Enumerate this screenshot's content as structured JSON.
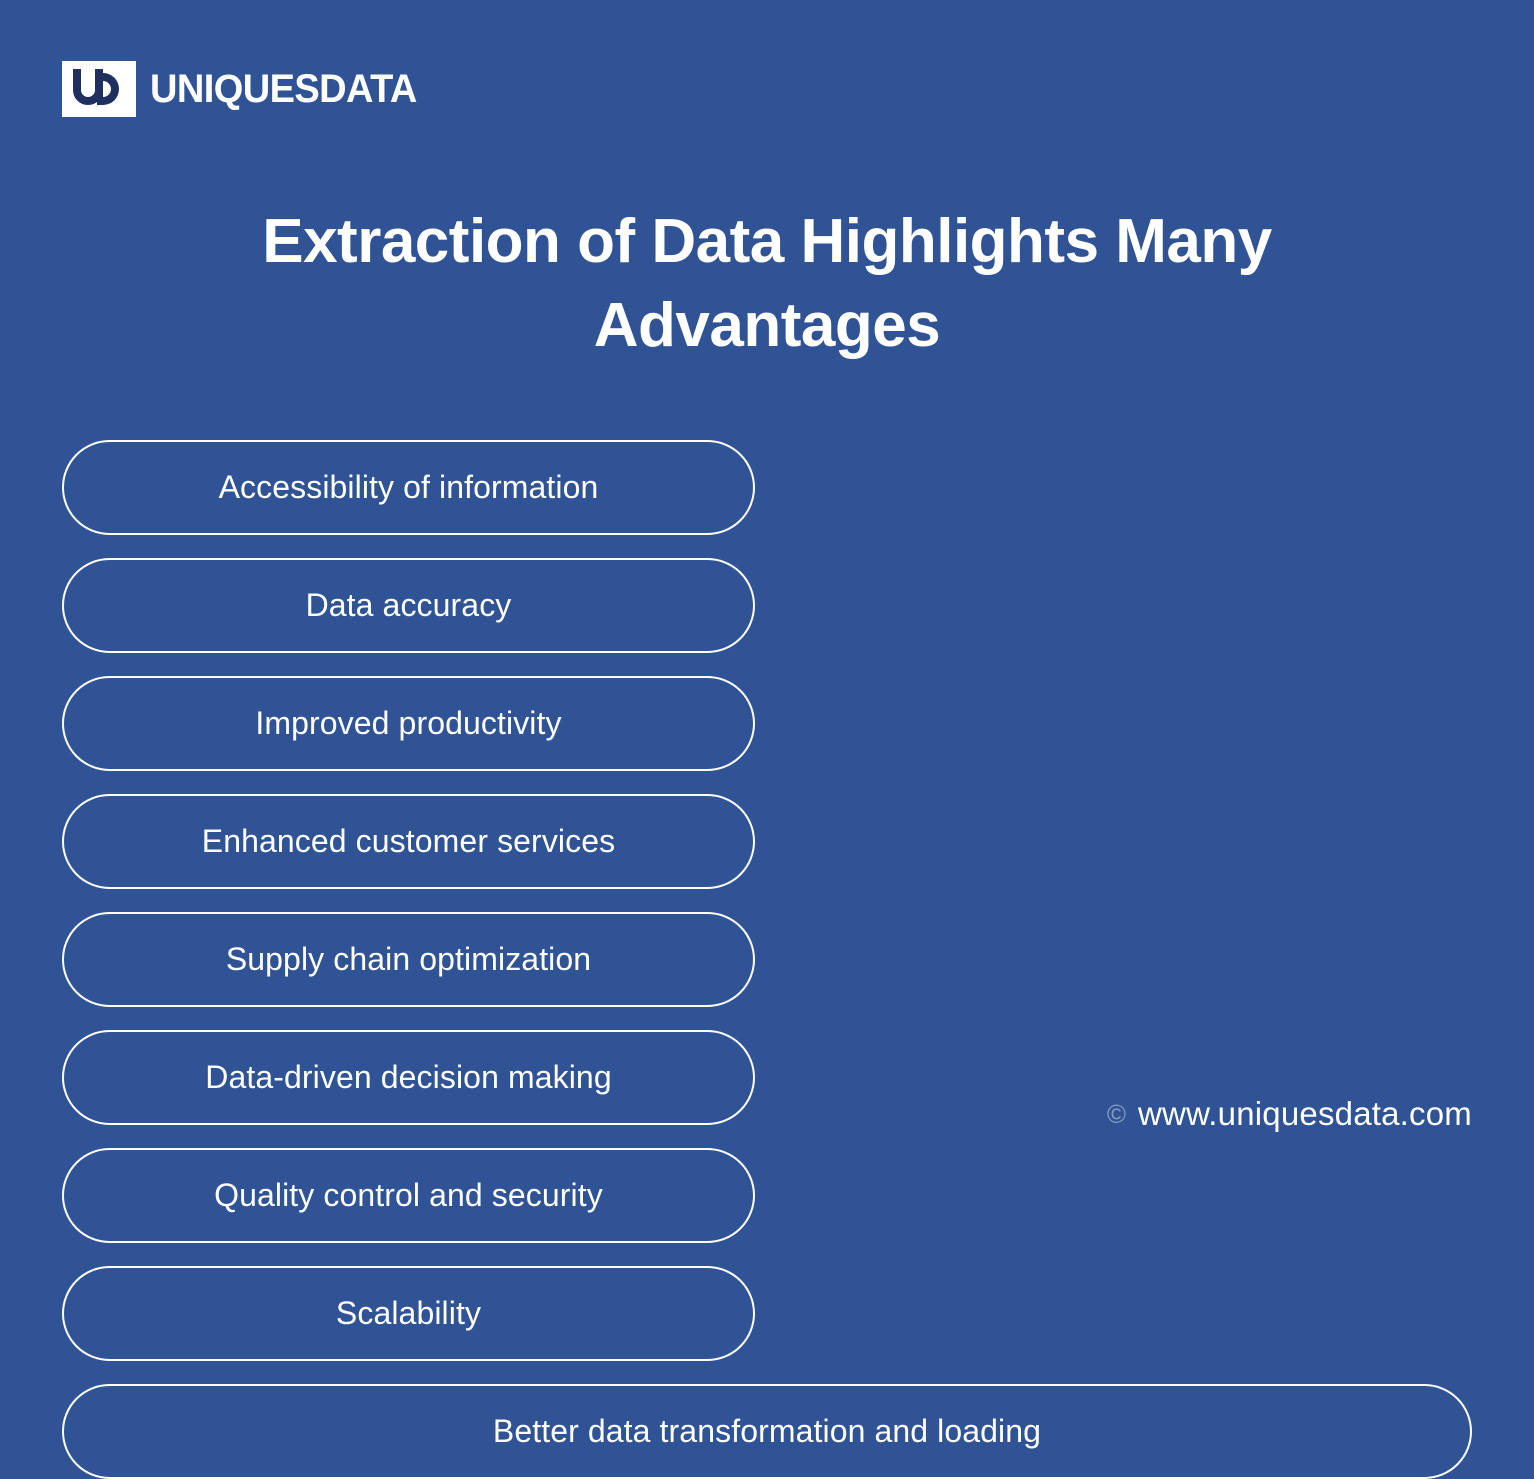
{
  "theme": {
    "background": "#2f5394",
    "foreground": "#ffffff",
    "logo_mark_bg": "#ffffff",
    "logo_mark_fg": "#1f2f5e",
    "pill_border": "#ffffff",
    "copyright_symbol_color": "rgba(255,255,255,0.42)"
  },
  "brand": {
    "logo_icon": "ud-monogram-icon",
    "name": "UNIQUESDATA"
  },
  "title": "Extraction of Data Highlights Many Advantages",
  "advantages": [
    {
      "label": "Accessibility of information",
      "column": "left",
      "row": 1,
      "full_width": false
    },
    {
      "label": "Data accuracy",
      "column": "right",
      "row": 1,
      "full_width": false
    },
    {
      "label": "Improved productivity",
      "column": "left",
      "row": 2,
      "full_width": false
    },
    {
      "label": "Enhanced customer services",
      "column": "right",
      "row": 2,
      "full_width": false
    },
    {
      "label": "Supply chain optimization",
      "column": "left",
      "row": 3,
      "full_width": false
    },
    {
      "label": "Data-driven decision making",
      "column": "right",
      "row": 3,
      "full_width": false
    },
    {
      "label": "Quality control and security",
      "column": "left",
      "row": 4,
      "full_width": false
    },
    {
      "label": "Scalability",
      "column": "right",
      "row": 4,
      "full_width": false
    },
    {
      "label": "Better data transformation and loading",
      "column": "full",
      "row": 5,
      "full_width": true
    }
  ],
  "footer": {
    "copyright_icon": "copyright-icon",
    "copyright_symbol": "©",
    "url": "www.uniquesdata.com"
  }
}
